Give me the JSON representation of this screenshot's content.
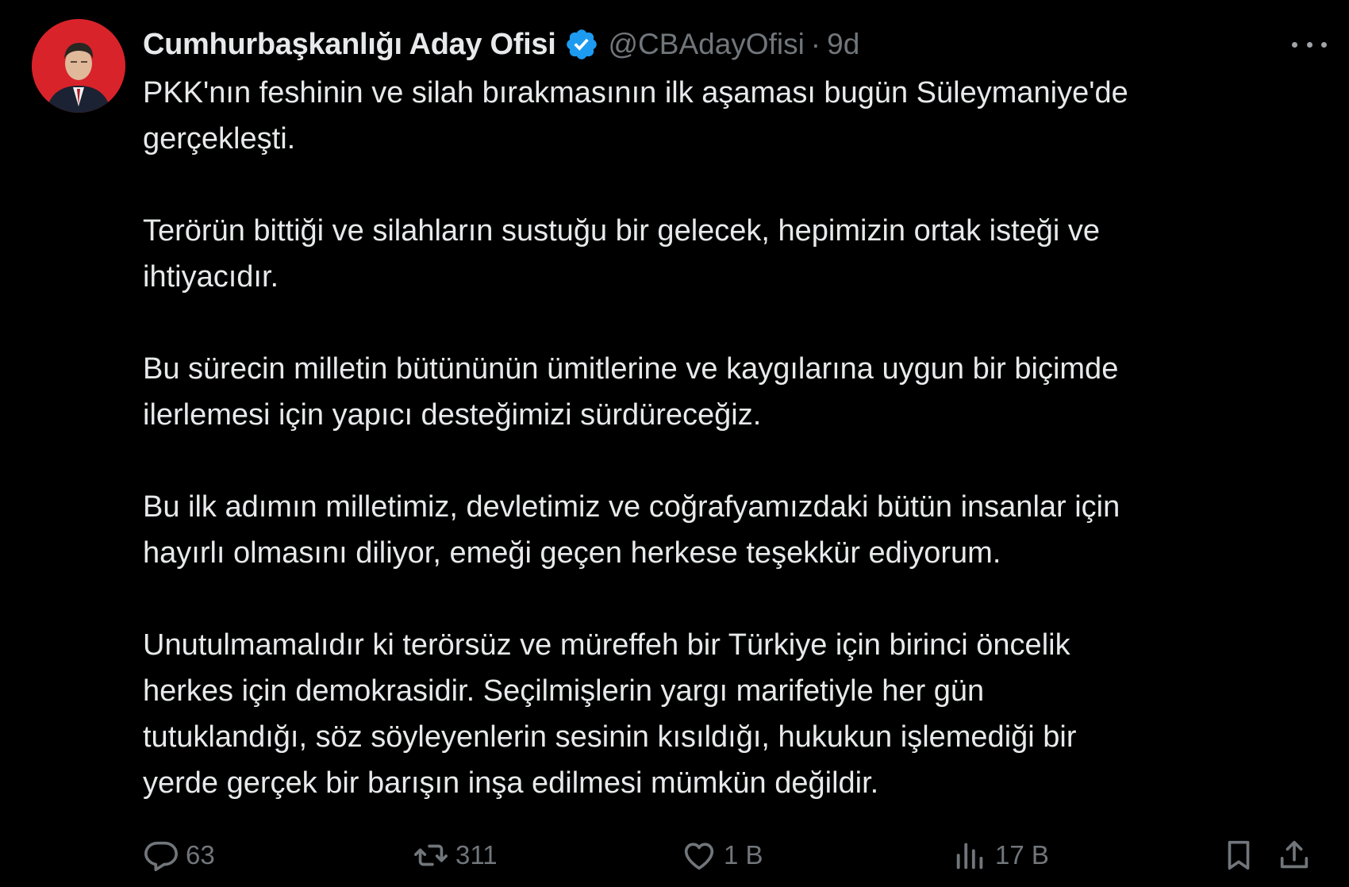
{
  "tweet": {
    "author": {
      "display_name": "Cumhurbaşkanlığı Aday Ofisi",
      "handle": "@CBAdayOfisi",
      "verified": true,
      "separator": "·",
      "time": "9d"
    },
    "paragraphs": [
      "PKK'nın feshinin ve silah bırakmasının ilk aşaması bugün Süleymaniye'de\ngerçekleşti.",
      "Terörün bittiği ve silahların sustuğu bir gelecek, hepimizin ortak isteği ve\nihtiyacıdır.",
      "Bu sürecin milletin bütününün ümitlerine ve kaygılarına uygun bir biçimde\nilerlemesi için yapıcı desteğimizi sürdüreceğiz.",
      "Bu ilk adımın milletimiz, devletimiz ve coğrafyamızdaki bütün insanlar için\nhayırlı olmasını diliyor, emeği geçen herkese teşekkür ediyorum.",
      "Unutulmamalıdır ki terörsüz ve müreffeh bir Türkiye için birinci öncelik\nherkes için demokrasidir. Seçilmişlerin yargı marifetiyle her gün\ntutuklandığı, söz söyleyenlerin sesinin kısıldığı, hukukun işlemediği bir\nyerde gerçek bir barışın inşa edilmesi mümkün değildir."
    ],
    "stats": {
      "replies": "63",
      "reposts": "311",
      "likes": "1 B",
      "views": "17 B"
    }
  },
  "icons": {
    "reply": "speech-bubble-icon",
    "repost": "repost-arrows-icon",
    "like": "heart-icon",
    "views": "bar-chart-icon",
    "bookmark": "bookmark-icon",
    "share": "share-upload-icon",
    "more": "more-horizontal-icon",
    "verified": "verified-badge-icon"
  },
  "colors": {
    "background": "#000000",
    "text": "#e7e9ea",
    "muted": "#71767b",
    "verified": "#1d9bf0"
  }
}
